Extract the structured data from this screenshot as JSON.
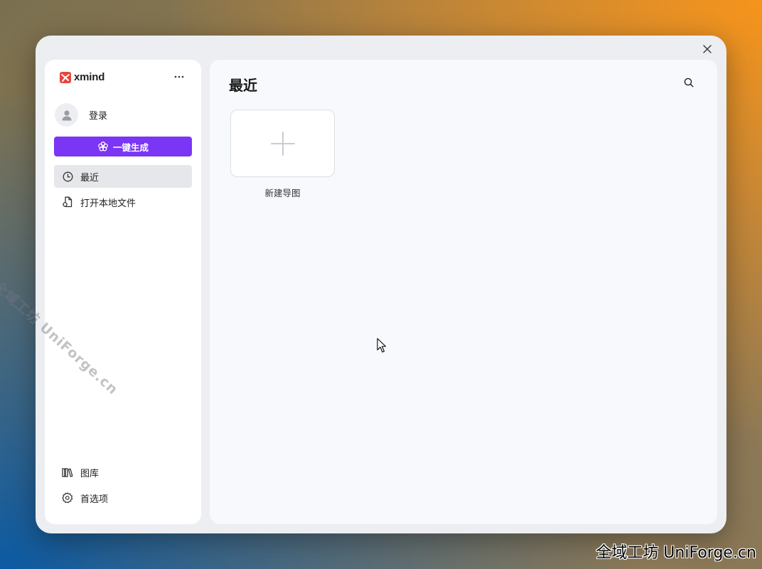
{
  "app": {
    "brand_name": "xmind",
    "accent_color": "#7b35f5",
    "logo_color": "#e8453c"
  },
  "sidebar": {
    "more_icon": "more-horizontal-icon",
    "user": {
      "label": "登录",
      "icon": "user-avatar-icon"
    },
    "generate_button": {
      "label": "一键生成",
      "icon": "ai-flower-icon"
    },
    "nav": [
      {
        "label": "最近",
        "icon": "clock-icon",
        "active": true
      },
      {
        "label": "打开本地文件",
        "icon": "file-icon",
        "active": false
      }
    ],
    "bottom_nav": [
      {
        "label": "图库",
        "icon": "library-icon"
      },
      {
        "label": "首选项",
        "icon": "gear-icon"
      }
    ]
  },
  "main": {
    "title": "最近",
    "search_icon": "search-icon",
    "new_card": {
      "label": "新建导图",
      "icon": "plus-icon"
    }
  },
  "window": {
    "close_icon": "close-icon"
  },
  "watermark": {
    "diagonal": "全域工坊 UniForge.cn",
    "corner": "全域工坊 UniForge.cn"
  }
}
